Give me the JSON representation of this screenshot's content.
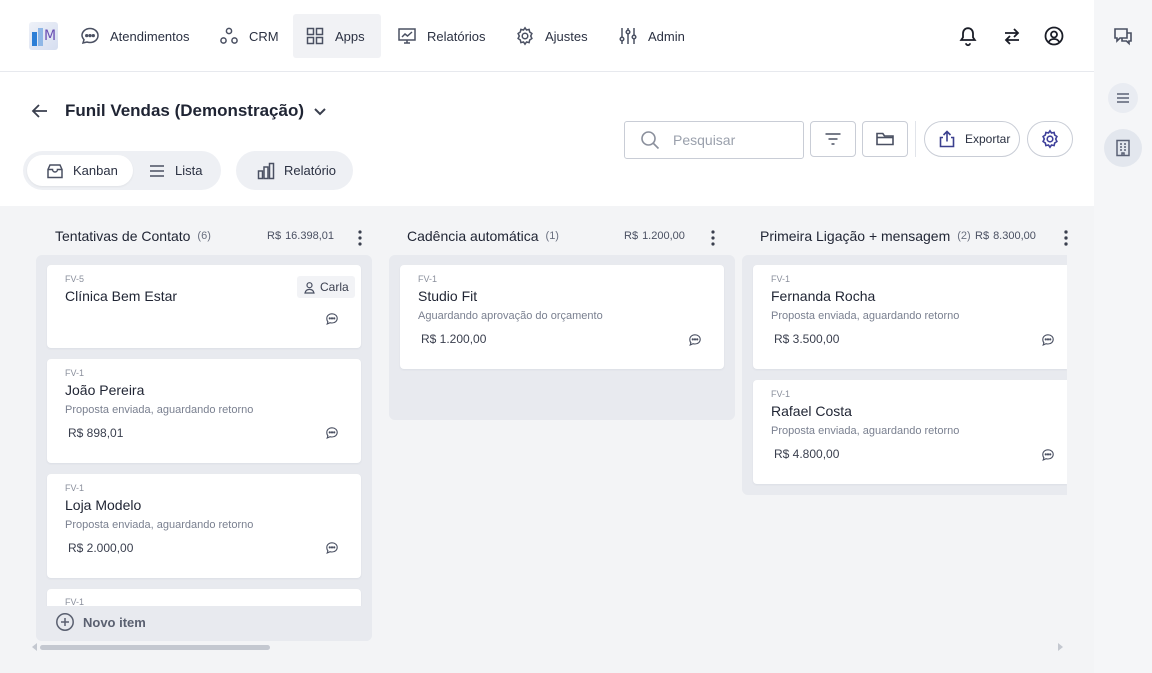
{
  "nav": {
    "items": [
      {
        "label": "Atendimentos",
        "icon": "chat-bubble-icon"
      },
      {
        "label": "CRM",
        "icon": "crm-nodes-icon"
      },
      {
        "label": "Apps",
        "icon": "apps-grid-icon",
        "active": true
      },
      {
        "label": "Relatórios",
        "icon": "report-chart-icon"
      },
      {
        "label": "Ajustes",
        "icon": "gear-icon"
      },
      {
        "label": "Admin",
        "icon": "sliders-icon"
      }
    ]
  },
  "header": {
    "title": "Funil Vendas (Demonstração)",
    "search_placeholder": "Pesquisar",
    "export_label": "Exportar"
  },
  "views": {
    "kanban": "Kanban",
    "list": "Lista",
    "report": "Relatório"
  },
  "columns": [
    {
      "title": "Tentativas de Contato",
      "count": "(6)",
      "currency": "R$",
      "total": "16.398,01",
      "cards": [
        {
          "code": "FV-5",
          "name": "Clínica Bem Estar",
          "owner": "Carla"
        },
        {
          "code": "FV-1",
          "name": "João Pereira",
          "desc": "Proposta enviada, aguardando retorno",
          "amount": "R$ 898,01"
        },
        {
          "code": "FV-1",
          "name": "Loja Modelo",
          "desc": "Proposta enviada, aguardando retorno",
          "amount": "R$ 2.000,00"
        },
        {
          "code": "FV-1"
        }
      ],
      "new_item": "Novo item"
    },
    {
      "title": "Cadência automática",
      "count": "(1)",
      "currency": "R$",
      "total": "1.200,00",
      "cards": [
        {
          "code": "FV-1",
          "name": "Studio Fit",
          "desc": "Aguardando aprovação do orçamento",
          "amount": "R$ 1.200,00"
        }
      ]
    },
    {
      "title": "Primeira Ligação + mensagem",
      "count": "(2)",
      "currency": "R$",
      "total": "8.300,00",
      "cards": [
        {
          "code": "FV-1",
          "name": "Fernanda Rocha",
          "desc": "Proposta enviada, aguardando retorno",
          "amount": "R$ 3.500,00"
        },
        {
          "code": "FV-1",
          "name": "Rafael Costa",
          "desc": "Proposta enviada, aguardando retorno",
          "amount": "R$ 4.800,00"
        }
      ]
    }
  ]
}
